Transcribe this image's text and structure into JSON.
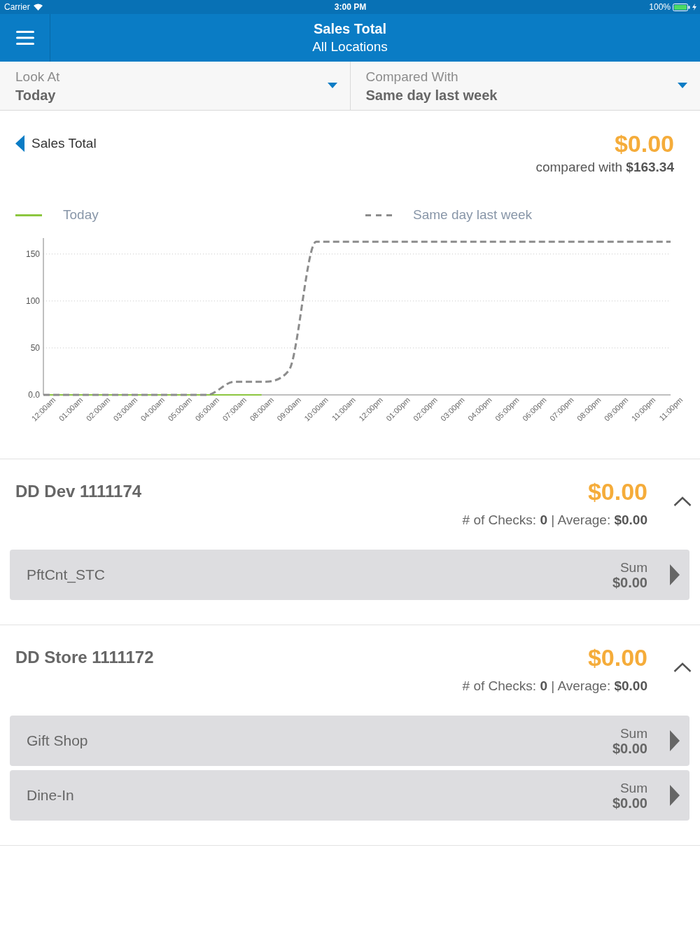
{
  "status_bar": {
    "carrier": "Carrier",
    "time": "3:00 PM",
    "battery": "100%"
  },
  "nav_bar": {
    "title": "Sales Total",
    "subtitle": "All Locations"
  },
  "filters": [
    {
      "label": "Look At",
      "value": "Today"
    },
    {
      "label": "Compared With",
      "value": "Same day last week"
    }
  ],
  "summary": {
    "title": "Sales Total",
    "amount": "$0.00",
    "comparison": "compared with **$163.34**",
    "chart_data": {
      "type": "line",
      "categories": [
        "12:00am",
        "01:00am",
        "02:00am",
        "03:00am",
        "04:00am",
        "05:00am",
        "06:00am",
        "07:00am",
        "08:00am",
        "09:00am",
        "10:00am",
        "11:00am",
        "12:00pm",
        "01:00pm",
        "02:00pm",
        "03:00pm",
        "04:00pm",
        "05:00pm",
        "06:00pm",
        "07:00pm",
        "08:00pm",
        "09:00pm",
        "10:00pm",
        "11:00pm"
      ],
      "series": [
        {
          "name": "Today",
          "color": "#8cc63f",
          "line_style": "solid",
          "values": [
            0,
            0,
            0,
            0,
            0,
            0,
            0,
            0,
            0,
            null,
            null,
            null,
            null,
            null,
            null,
            null,
            null,
            null,
            null,
            null,
            null,
            null,
            null,
            null
          ]
        },
        {
          "name": "Same day last week",
          "color": "#8c8c8c",
          "line_style": "dashed",
          "values": [
            0,
            0,
            0,
            0,
            0,
            0,
            0,
            14,
            14,
            26,
            163,
            163,
            163,
            163,
            163,
            163,
            163,
            163,
            163,
            163,
            163,
            163,
            163,
            163
          ]
        }
      ],
      "ylim": [
        0,
        167
      ],
      "yticks": [
        {
          "value": 0,
          "label": "0.0"
        },
        50,
        100,
        150
      ],
      "grid": "y"
    }
  },
  "locations": [
    {
      "name": "DD Dev 1111174",
      "amount": "$0.00",
      "stats": "# of Checks: **0** | Average: **$0.00**",
      "expanded": true,
      "rows": [
        {
          "name": "PftCnt_STC",
          "sum_label": "Sum",
          "sum": "$0.00"
        }
      ]
    },
    {
      "name": "DD Store 1111172",
      "amount": "$0.00",
      "stats": "# of Checks: **0** | Average: **$0.00**",
      "expanded": true,
      "rows": [
        {
          "name": "Gift Shop",
          "sum_label": "Sum",
          "sum": "$0.00"
        },
        {
          "name": "Dine-In",
          "sum_label": "Sum",
          "sum": "$0.00"
        }
      ]
    }
  ]
}
